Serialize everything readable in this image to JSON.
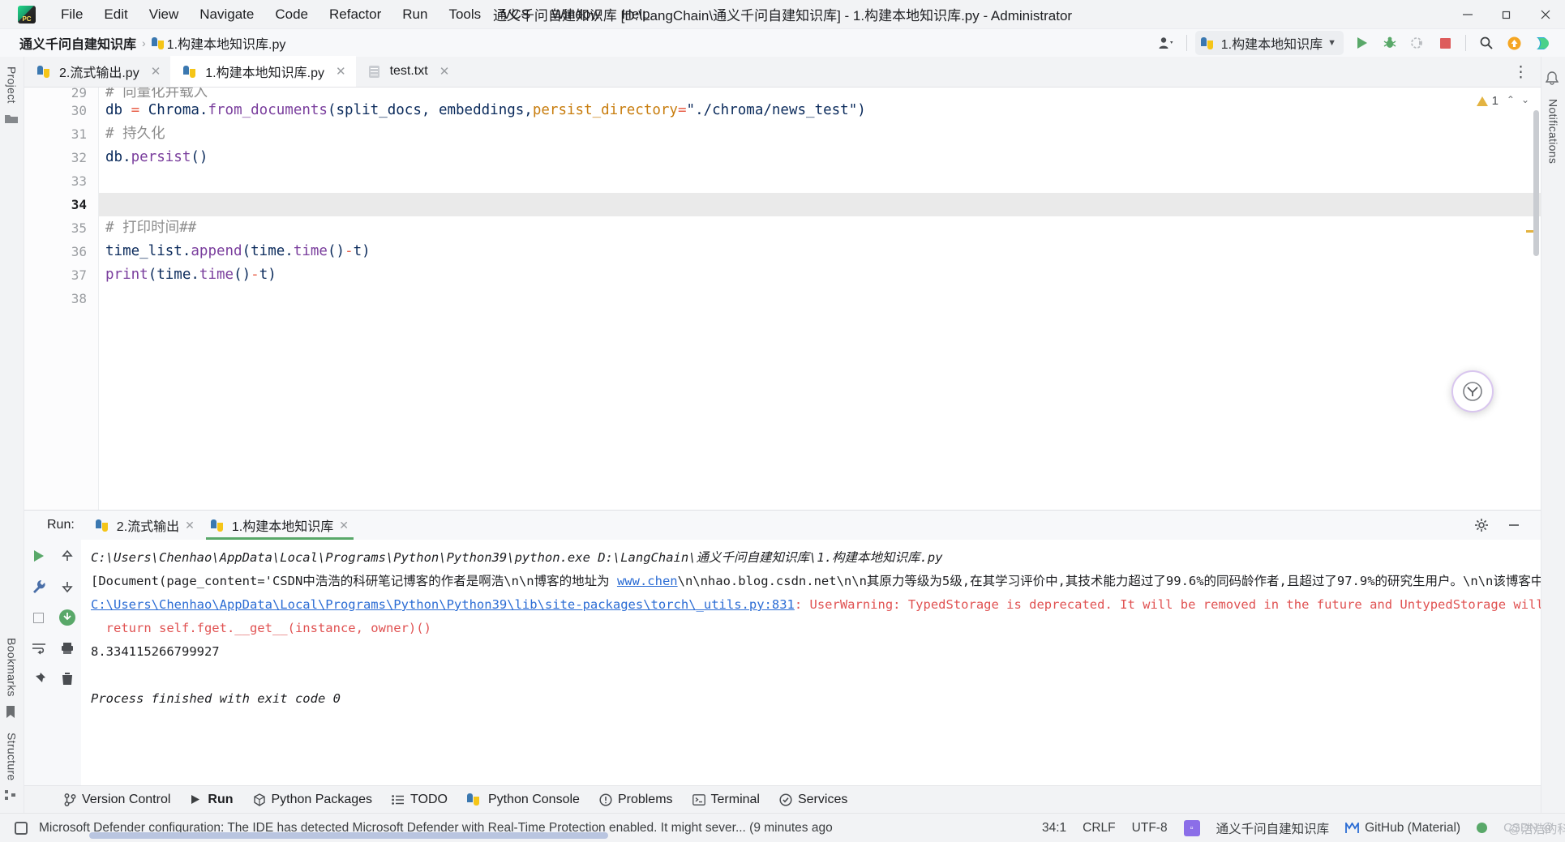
{
  "window": {
    "title": "通义千问自建知识库 [D:\\LangChain\\通义千问自建知识库] - 1.构建本地知识库.py - Administrator",
    "logo_text": "PC",
    "minimize": "─",
    "maximize": "❐",
    "close": "✕"
  },
  "menu": {
    "items": [
      {
        "label": "File"
      },
      {
        "label": "Edit"
      },
      {
        "label": "View"
      },
      {
        "label": "Navigate"
      },
      {
        "label": "Code"
      },
      {
        "label": "Refactor"
      },
      {
        "label": "Run"
      },
      {
        "label": "Tools"
      },
      {
        "label": "VCS"
      },
      {
        "label": "Window"
      },
      {
        "label": "Help"
      }
    ]
  },
  "breadcrumb": {
    "project": "通义千问自建知识库",
    "separator": "›",
    "file": "1.构建本地知识库.py"
  },
  "toolbar": {
    "run_config": "1.构建本地知识库",
    "dropdown_caret": "▼",
    "user_caret": "▾",
    "run_tooltip": "Run",
    "debug_tooltip": "Debug",
    "coverage_tooltip": "Run with Coverage",
    "stop_tooltip": "Stop",
    "search_tooltip": "Search Everywhere",
    "update_tooltip": "Update Project",
    "ai_tooltip": "AI Assistant"
  },
  "editor_tabs": [
    {
      "label": "2.流式输出.py",
      "icon": "python-file-icon",
      "active": false,
      "close": "✕"
    },
    {
      "label": "1.构建本地知识库.py",
      "icon": "python-file-icon",
      "active": true,
      "close": "✕"
    },
    {
      "label": "test.txt",
      "icon": "text-file-icon",
      "active": false,
      "close": "✕"
    }
  ],
  "tabs_overflow": "⋮",
  "editor": {
    "warning_count": "1",
    "prev_marker": "⌃",
    "next_marker": "⌄",
    "partial_top_line": {
      "number": "29",
      "text": "# 向量化并载入"
    },
    "lines": [
      {
        "number": "30",
        "current": false,
        "tokens": [
          {
            "t": "db ",
            "c": "plain"
          },
          {
            "t": "=",
            "c": "op"
          },
          {
            "t": " Chroma",
            "c": "plain"
          },
          {
            "t": ".",
            "c": "plain"
          },
          {
            "t": "from_documents",
            "c": "fn"
          },
          {
            "t": "(split_docs, embeddings,",
            "c": "plain"
          },
          {
            "t": "persist_directory",
            "c": "param"
          },
          {
            "t": "=",
            "c": "op"
          },
          {
            "t": "\"./chroma/news_test\"",
            "c": "plain"
          },
          {
            "t": ")",
            "c": "plain"
          }
        ]
      },
      {
        "number": "31",
        "current": false,
        "tokens": [
          {
            "t": "# 持久化",
            "c": "cmt"
          }
        ]
      },
      {
        "number": "32",
        "current": false,
        "tokens": [
          {
            "t": "db",
            "c": "plain"
          },
          {
            "t": ".",
            "c": "plain"
          },
          {
            "t": "persist",
            "c": "fn"
          },
          {
            "t": "()",
            "c": "plain"
          }
        ]
      },
      {
        "number": "33",
        "current": false,
        "tokens": [
          {
            "t": "",
            "c": "plain"
          }
        ]
      },
      {
        "number": "34",
        "current": true,
        "tokens": [
          {
            "t": "",
            "c": "plain"
          }
        ]
      },
      {
        "number": "35",
        "current": false,
        "tokens": [
          {
            "t": "# 打印时间##",
            "c": "cmt"
          }
        ]
      },
      {
        "number": "36",
        "current": false,
        "tokens": [
          {
            "t": "time_list",
            "c": "plain"
          },
          {
            "t": ".",
            "c": "plain"
          },
          {
            "t": "append",
            "c": "fn"
          },
          {
            "t": "(time",
            "c": "plain"
          },
          {
            "t": ".",
            "c": "plain"
          },
          {
            "t": "time",
            "c": "fn"
          },
          {
            "t": "()",
            "c": "plain"
          },
          {
            "t": "-",
            "c": "op"
          },
          {
            "t": "t)",
            "c": "plain"
          }
        ]
      },
      {
        "number": "37",
        "current": false,
        "tokens": [
          {
            "t": "print",
            "c": "fn"
          },
          {
            "t": "(time",
            "c": "plain"
          },
          {
            "t": ".",
            "c": "plain"
          },
          {
            "t": "time",
            "c": "fn"
          },
          {
            "t": "()",
            "c": "plain"
          },
          {
            "t": "-",
            "c": "op"
          },
          {
            "t": "t)",
            "c": "plain"
          }
        ]
      },
      {
        "number": "38",
        "current": false,
        "tokens": [
          {
            "t": "",
            "c": "plain"
          }
        ]
      }
    ]
  },
  "run_panel": {
    "label": "Run:",
    "tabs": [
      {
        "label": "2.流式输出",
        "active": false,
        "close": "✕"
      },
      {
        "label": "1.构建本地知识库",
        "active": true,
        "close": "✕"
      }
    ],
    "settings_icon": "gear-icon",
    "minimize_icon": "minimize-icon",
    "console_lines": [
      {
        "style": "italic",
        "segments": [
          {
            "t": "C:\\Users\\Chenhao\\AppData\\Local\\Programs\\Python\\Python39\\python.exe D:\\LangChain\\通义千问自建知识库\\1.构建本地知识库.py",
            "k": "plain"
          }
        ]
      },
      {
        "style": "normal",
        "segments": [
          {
            "t": "[Document(page_content='CSDN中浩浩的科研笔记博客的作者是啊浩\\n\\n博客的地址为 ",
            "k": "plain"
          },
          {
            "t": "www.chen",
            "k": "link"
          },
          {
            "t": "\\n\\nhao.blog.csdn.net\\n\\n其原力等级为5级,在其学习评价中,其技术能力超过了99.6%的同码龄作者,且超过了97.9%的研究生用户。\\n\\n该博客中包",
            "k": "plain"
          }
        ]
      },
      {
        "style": "normal",
        "segments": [
          {
            "t": "C:\\Users\\Chenhao\\AppData\\Local\\Programs\\Python\\Python39\\lib\\site-packages\\torch\\_utils.py:831",
            "k": "link"
          },
          {
            "t": ": UserWarning: TypedStorage is deprecated. It will be removed in the future and UntypedStorage will be t",
            "k": "red"
          }
        ]
      },
      {
        "style": "normal",
        "segments": [
          {
            "t": "  return self.fget.__get__(instance, owner)()",
            "k": "red"
          }
        ]
      },
      {
        "style": "normal",
        "segments": [
          {
            "t": "8.334115266799927",
            "k": "plain"
          }
        ]
      },
      {
        "style": "normal",
        "segments": [
          {
            "t": "",
            "k": "plain"
          }
        ]
      },
      {
        "style": "italic",
        "segments": [
          {
            "t": "Process finished with exit code 0",
            "k": "plain"
          }
        ]
      }
    ]
  },
  "toolwindow_bar": {
    "items": [
      {
        "label": "Version Control",
        "icon": "branch-icon",
        "active": false
      },
      {
        "label": "Run",
        "icon": "run-icon",
        "active": true
      },
      {
        "label": "Python Packages",
        "icon": "packages-icon",
        "active": false
      },
      {
        "label": "TODO",
        "icon": "todo-icon",
        "active": false
      },
      {
        "label": "Python Console",
        "icon": "console-icon",
        "active": false
      },
      {
        "label": "Problems",
        "icon": "problems-icon",
        "active": false
      },
      {
        "label": "Terminal",
        "icon": "terminal-icon",
        "active": false
      },
      {
        "label": "Services",
        "icon": "services-icon",
        "active": false
      }
    ]
  },
  "status_bar": {
    "message": "Microsoft Defender configuration: The IDE has detected Microsoft Defender with Real-Time Protection enabled. It might sever... (9 minutes ago",
    "caret_position": "34:1",
    "line_separator": "CRLF",
    "encoding": "UTF-8",
    "branch_chip": "▫",
    "project_name": "通义千问自建知识库",
    "vcs": "GitHub (Material)",
    "inspection_label": "OK",
    "watermark_en": "CSDN @",
    "watermark_cn": "@浩浩的科研笔记"
  },
  "left_rail": {
    "project_label": "Project",
    "bookmarks_label": "Bookmarks",
    "structure_label": "Structure"
  },
  "right_rail": {
    "notifications_label": "Notifications"
  },
  "floating_widget": {
    "glyph": "ⓨ",
    "name": "assistant-widget"
  },
  "colors": {
    "accent_green": "#59a869",
    "accent_red": "#dd5c5c",
    "link_blue": "#2b6cd4",
    "error_red": "#e05252",
    "keyword_blue": "#0033b3",
    "function_purple": "#7a3e9d",
    "param_orange": "#c87d0e"
  }
}
